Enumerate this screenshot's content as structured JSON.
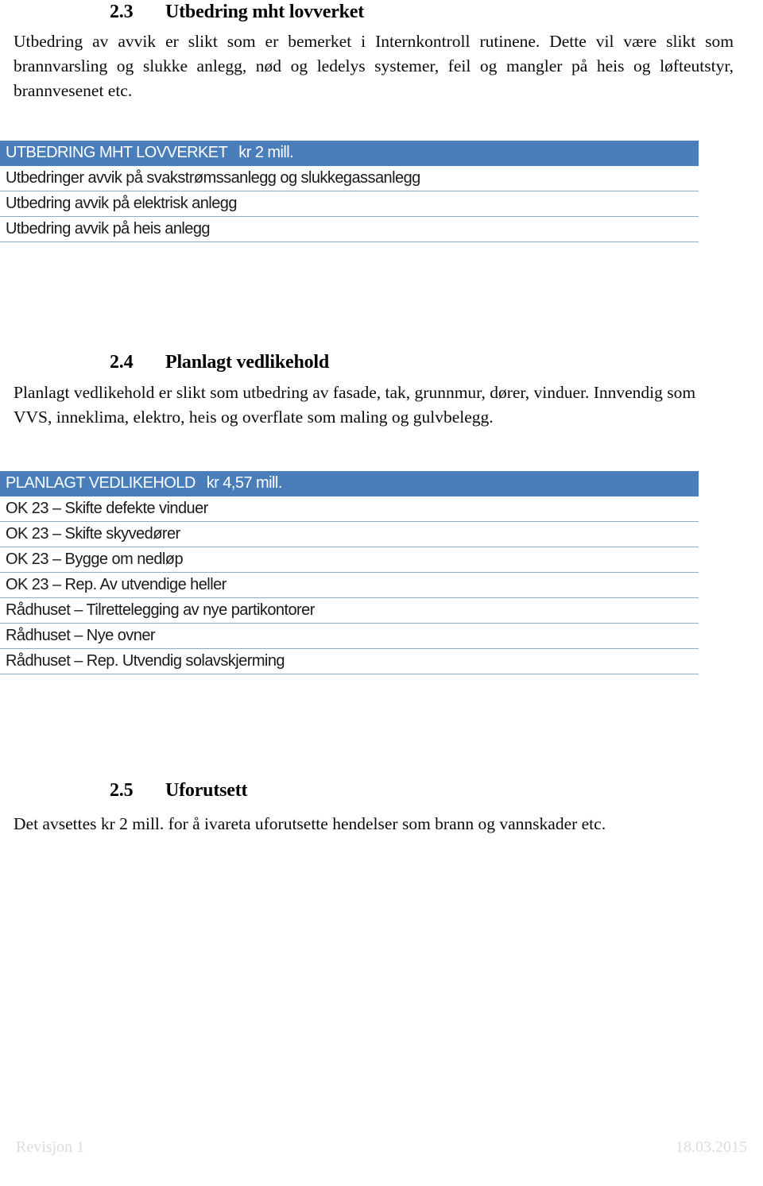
{
  "document": {
    "sections": [
      {
        "number": "2.3",
        "title": "Utbedring mht lovverket",
        "paragraph": "Utbedring av avvik er slikt som er bemerket i Internkontroll rutinene.  Dette vil være slikt som brannvarsling og slukke anlegg, nød og ledelys systemer, feil og mangler på heis og løfteutstyr, brannvesenet etc."
      },
      {
        "number": "2.4",
        "title": "Planlagt vedlikehold",
        "paragraph": "Planlagt vedlikehold er slikt som utbedring av fasade, tak, grunnmur, dører, vinduer. Innvendig som VVS, inneklima, elektro, heis og overflate som maling og gulvbelegg."
      },
      {
        "number": "2.5",
        "title": "Uforutsett",
        "paragraph": "Det avsettes kr 2 mill. for å ivareta uforutsette hendelser som brann og vannskader etc."
      }
    ],
    "tables": [
      {
        "header_title": "UTBEDRING MHT LOVVERKET",
        "header_amount": "kr 2 mill.",
        "rows": [
          "Utbedringer avvik på svakstrømssanlegg og slukkegassanlegg",
          "Utbedring avvik på elektrisk anlegg",
          "Utbedring avvik på heis anlegg"
        ],
        "has_trailing_blank_row": true
      },
      {
        "header_title": "PLANLAGT VEDLIKEHOLD",
        "header_amount": "kr  4,57 mill.",
        "rows": [
          "OK 23 – Skifte defekte vinduer",
          "OK 23 – Skifte skyvedører",
          "OK 23 – Bygge om nedløp",
          "OK 23 – Rep. Av utvendige heller",
          "Rådhuset – Tilrettelegging av nye partikontorer",
          "Rådhuset – Nye ovner",
          "Rådhuset – Rep. Utvendig solavskjerming"
        ],
        "has_trailing_blank_row": false
      }
    ],
    "footer": {
      "revision": "Revisjon 1",
      "date": "18.03.2015"
    },
    "colors": {
      "table_header_bg": "#4a7ebb",
      "table_header_text": "#ffffff",
      "table_rule": "#8eaac8",
      "footer_text": "#dcdcdc",
      "body_text": "#000000"
    }
  }
}
